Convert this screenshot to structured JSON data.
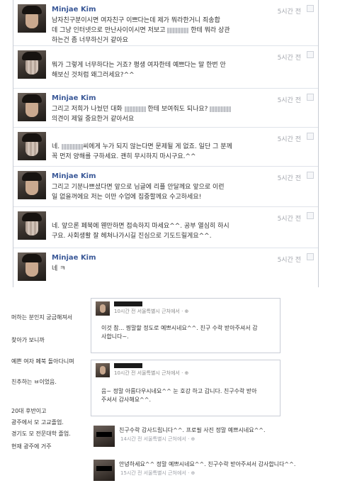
{
  "messages": [
    {
      "sender": "Minjae Kim",
      "time": "5시간 전",
      "lines": [
        "남자친구분이시면 여자친구 이쁘다는데 제가 뭐라한거니 죄송합",
        "데 그냥 인터넷으로 만난사이이시면 저보고 ",
        " 한테 뭐라 상관",
        "하는건 좀 너무하신거 같아요"
      ]
    },
    {
      "sender": "",
      "time": "5시간 전",
      "lines": [
        "뭐가 그렇게 너무하다는 거죠? 평생 여자한테 예쁘다는 말 한번 안",
        "해보신 것처럼 왜그러세요?^^"
      ]
    },
    {
      "sender": "Minjae Kim",
      "time": "5시간 전",
      "lines": [
        "그리고 저희가 나눴던 대화 ",
        " 한테 보여줘도 되나요? ",
        "의견이 제일 중요한거 같아서요"
      ]
    },
    {
      "sender": "",
      "time": "5시간 전",
      "lines": [
        "네. ",
        "씨에게 누가 되지 않는다면 문제될 게 없죠. 일단 그 분께",
        "꼭 먼저 양해를 구하세요. 괜히 무시하지 마시구요.^^"
      ]
    },
    {
      "sender": "Minjae Kim",
      "time": "5시간 전",
      "lines": [
        "그리고 기분나쁘셨다면 앞으로 님글에 리플 안달께요 앞으로 이런",
        "일 없을꺼에요 저는 이만 수업에 집중할께요 수고하세요!"
      ]
    },
    {
      "sender": "",
      "time": "5시간 전",
      "lines": [
        "네. 앞으론 페북에 웬만하면 접속하지 마세요^^. 공부 열심히 하시",
        "구요. 사회생활 잘 헤쳐나가시길 진심으로 기도드릴게요^^."
      ]
    },
    {
      "sender": "Minjae Kim",
      "time": "5시간 전",
      "lines": [
        "네 ㅋ"
      ]
    }
  ],
  "sidebar": {
    "lines": [
      "머하는 분인지 궁금해져서",
      "찾아가 보니까",
      "예쁜 여자 페북 돌아다니며",
      "친추하는 ㅂ이었음.",
      "20대 후반이고",
      "광주에서 모 고교졸업.",
      "경기도 모 전문대학 졸업.",
      "현재 광주에 거주"
    ]
  },
  "comments": [
    {
      "meta": "10시간 전 서울특별시 근처에서 · ⊕",
      "lines": [
        "이것 참... 찡말할 정도로 예쁘시네요^^. 친구 수락 받아주셔서 감",
        "사합니다~."
      ]
    },
    {
      "meta": "10시간 전 서울특별시 근처에서 · ⊕",
      "lines": [
        "음~ 정말 아름다우시네요^^ 눈 호강 하고 갑니다. 친구수락 받아",
        "주셔서 감사해요^^."
      ]
    }
  ],
  "replies": [
    {
      "text": "친구수락 감사드립니다^^. 프로필 사진 정말 예쁘시네요^^.",
      "meta": "14시간 전 서울특별시 근처에서 · ⊕"
    },
    {
      "text": "안녕하세요^^ 정말 예쁘시네요^^. 친구수락 받아주셔서 감사합니다^^.",
      "meta": "15시간 전 서울특별시 근처에서 · ⊕"
    }
  ]
}
